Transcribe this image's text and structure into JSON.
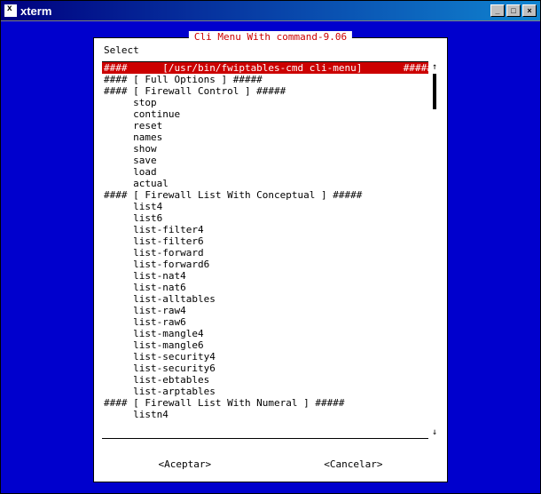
{
  "window": {
    "title": "xterm"
  },
  "dialog": {
    "title": "Cli Menu With command-9.06",
    "select_label": "Select"
  },
  "list": {
    "selected_index": 0,
    "rows": [
      "####      [/usr/bin/fwiptables-cmd cli-menu]       #####",
      "#### [ Full Options ] #####",
      "#### [ Firewall Control ] #####",
      "     stop",
      "     continue",
      "     reset",
      "     names",
      "     show",
      "     save",
      "     load",
      "     actual",
      "#### [ Firewall List With Conceptual ] #####",
      "     list4",
      "     list6",
      "     list-filter4",
      "     list-filter6",
      "     list-forward",
      "     list-forward6",
      "     list-nat4",
      "     list-nat6",
      "     list-alltables",
      "     list-raw4",
      "     list-raw6",
      "     list-mangle4",
      "     list-mangle6",
      "     list-security4",
      "     list-security6",
      "     list-ebtables",
      "     list-arptables",
      "#### [ Firewall List With Numeral ] #####",
      "     listn4"
    ]
  },
  "buttons": {
    "ok": "<Aceptar>",
    "cancel": "<Cancelar>"
  }
}
